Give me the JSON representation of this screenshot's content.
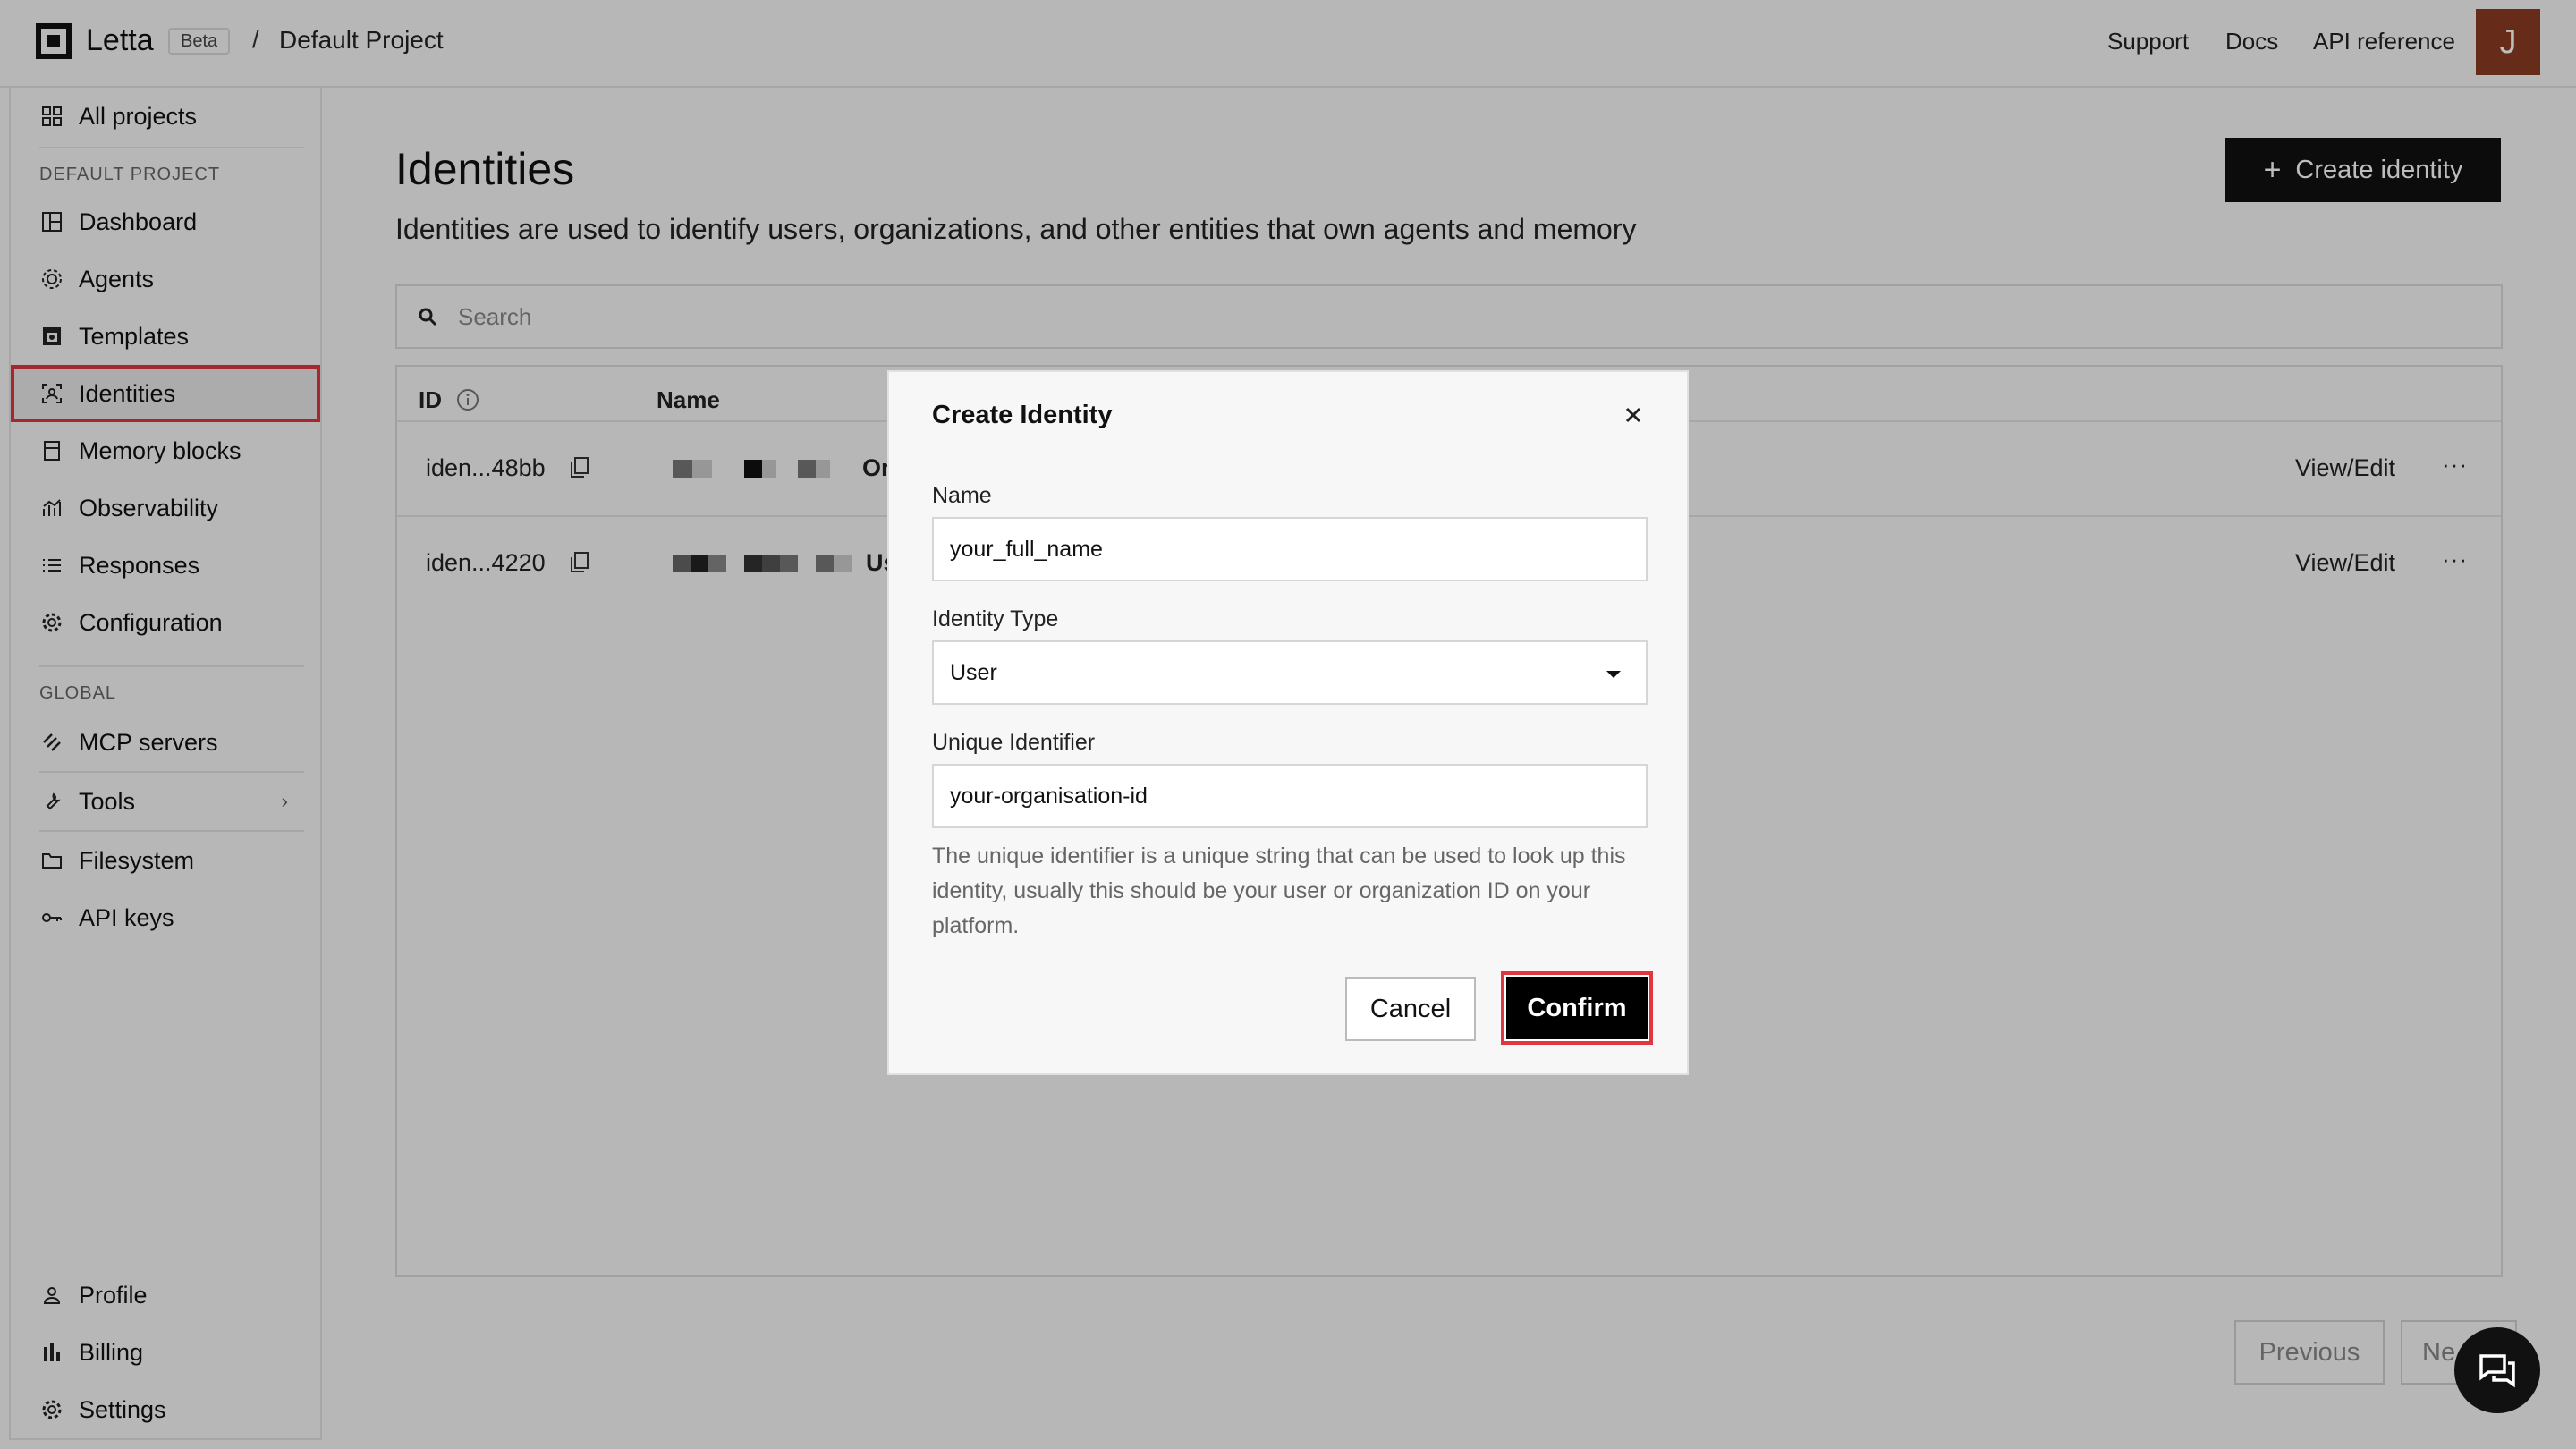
{
  "topbar": {
    "brand": "Letta",
    "badge": "Beta",
    "separator": "/",
    "project": "Default Project",
    "links": [
      "Support",
      "Docs",
      "API reference"
    ],
    "avatar_initial": "J",
    "avatar_color": "#8b3a22"
  },
  "sidebar": {
    "all_projects": "All projects",
    "section_project": "DEFAULT PROJECT",
    "project_items": [
      {
        "label": "Dashboard",
        "icon": "dashboard-icon"
      },
      {
        "label": "Agents",
        "icon": "agents-icon"
      },
      {
        "label": "Templates",
        "icon": "templates-icon"
      },
      {
        "label": "Identities",
        "icon": "identities-icon",
        "active": true
      },
      {
        "label": "Memory blocks",
        "icon": "memory-icon"
      },
      {
        "label": "Observability",
        "icon": "chart-icon"
      },
      {
        "label": "Responses",
        "icon": "list-icon"
      },
      {
        "label": "Configuration",
        "icon": "gear-icon"
      }
    ],
    "section_global": "GLOBAL",
    "global_items": [
      {
        "label": "MCP servers",
        "icon": "mcp-icon"
      },
      {
        "label": "Tools",
        "icon": "wrench-icon"
      },
      {
        "label": "Filesystem",
        "icon": "folder-icon"
      },
      {
        "label": "API keys",
        "icon": "key-icon"
      }
    ],
    "bottom_items": [
      {
        "label": "Profile",
        "icon": "user-icon"
      },
      {
        "label": "Billing",
        "icon": "bar-chart-icon"
      },
      {
        "label": "Settings",
        "icon": "gear-icon"
      }
    ]
  },
  "main": {
    "title": "Identities",
    "subtitle": "Identities are used to identify users, organizations, and other entities that own agents and memory",
    "create_button": "Create identity",
    "search_placeholder": "Search",
    "columns": [
      "ID",
      "Name"
    ],
    "rows": [
      {
        "id": "iden...48bb",
        "name_fragment": "Or",
        "action": "View/Edit"
      },
      {
        "id": "iden...4220",
        "name_fragment": "Us",
        "action": "View/Edit"
      }
    ],
    "pager": {
      "previous": "Previous",
      "next": "Ne"
    }
  },
  "modal": {
    "title": "Create Identity",
    "name_label": "Name",
    "name_value": "your_full_name",
    "type_label": "Identity Type",
    "type_value": "User",
    "uid_label": "Unique Identifier",
    "uid_value": "your-organisation-id",
    "help": "The unique identifier is a unique string that can be used to look up this identity, usually this should be your user or organization ID on your platform.",
    "cancel": "Cancel",
    "confirm": "Confirm"
  },
  "colors": {
    "highlight": "#e0363f",
    "primary": "#111111"
  }
}
